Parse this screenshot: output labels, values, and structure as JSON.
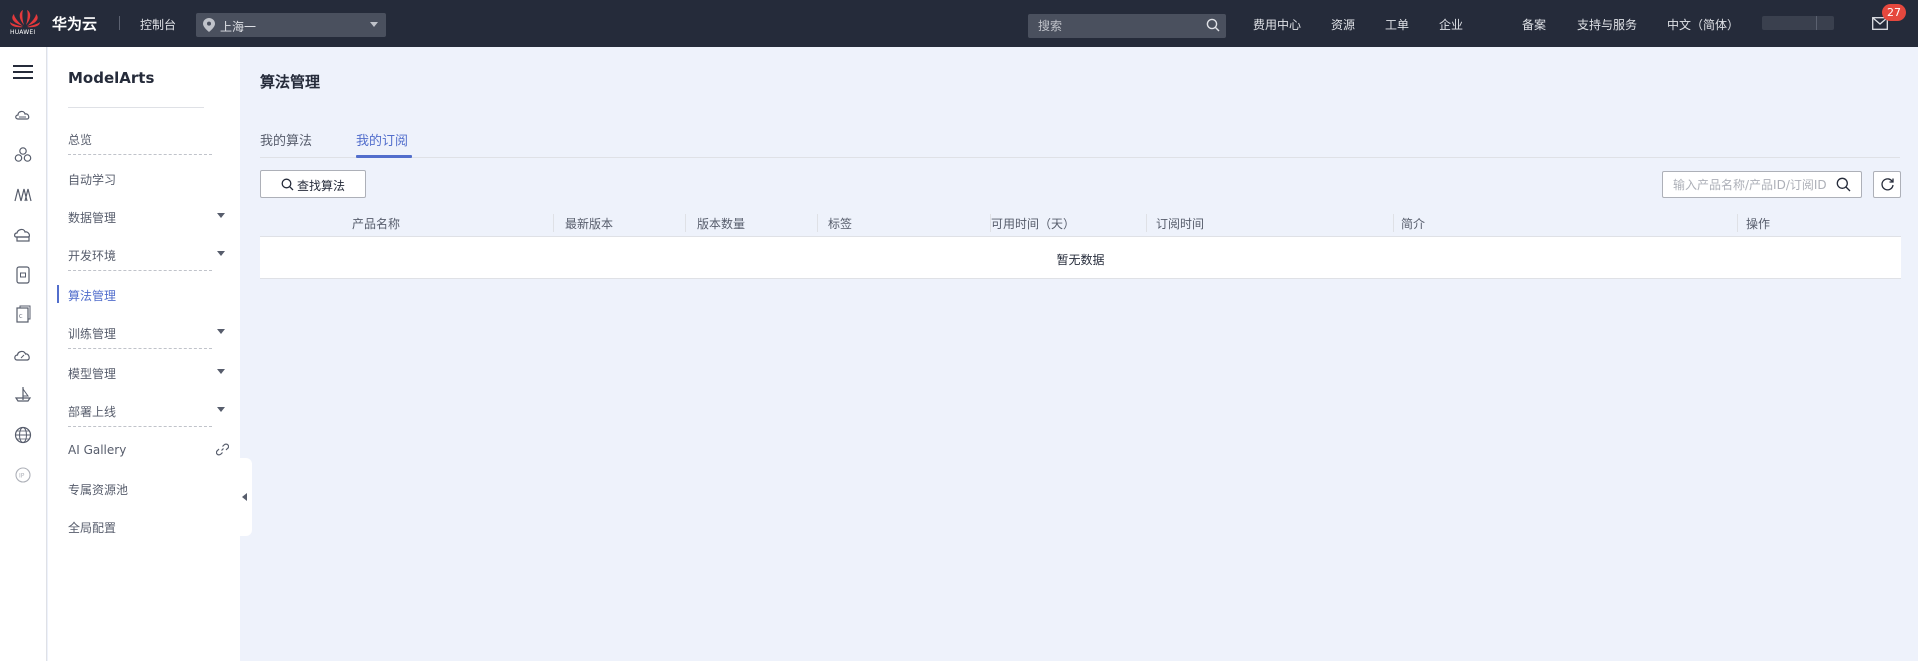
{
  "topbar": {
    "logo_text": "HUAWEI",
    "brand": "华为云",
    "console": "控制台",
    "region": "上海一",
    "search_placeholder": "搜索",
    "links": {
      "billing": "费用中心",
      "resources": "资源",
      "tickets": "工单",
      "enterprise": "企业",
      "icp": "备案",
      "support": "支持与服务",
      "language": "中文（简体）"
    },
    "mail_badge": "27"
  },
  "sidebar": {
    "title": "ModelArts",
    "items": [
      {
        "label": "总览"
      },
      {
        "label": "自动学习"
      },
      {
        "label": "数据管理"
      },
      {
        "label": "开发环境"
      },
      {
        "label": "算法管理"
      },
      {
        "label": "训练管理"
      },
      {
        "label": "模型管理"
      },
      {
        "label": "部署上线"
      },
      {
        "label": "AI Gallery"
      },
      {
        "label": "专属资源池"
      },
      {
        "label": "全局配置"
      }
    ]
  },
  "main": {
    "title": "算法管理",
    "tabs": [
      {
        "label": "我的算法"
      },
      {
        "label": "我的订阅"
      }
    ],
    "find_button": "查找算法",
    "search_placeholder": "输入产品名称/产品ID/订阅ID",
    "table": {
      "columns": [
        "产品名称",
        "最新版本",
        "版本数量",
        "标签",
        "可用时间（天）",
        "订阅时间",
        "简介",
        "操作"
      ],
      "empty_text": "暂无数据"
    }
  },
  "colors": {
    "topbar_bg": "#252b3a",
    "accent": "#526ecc",
    "page_bg": "#eef2fb",
    "badge": "#e5483e"
  }
}
